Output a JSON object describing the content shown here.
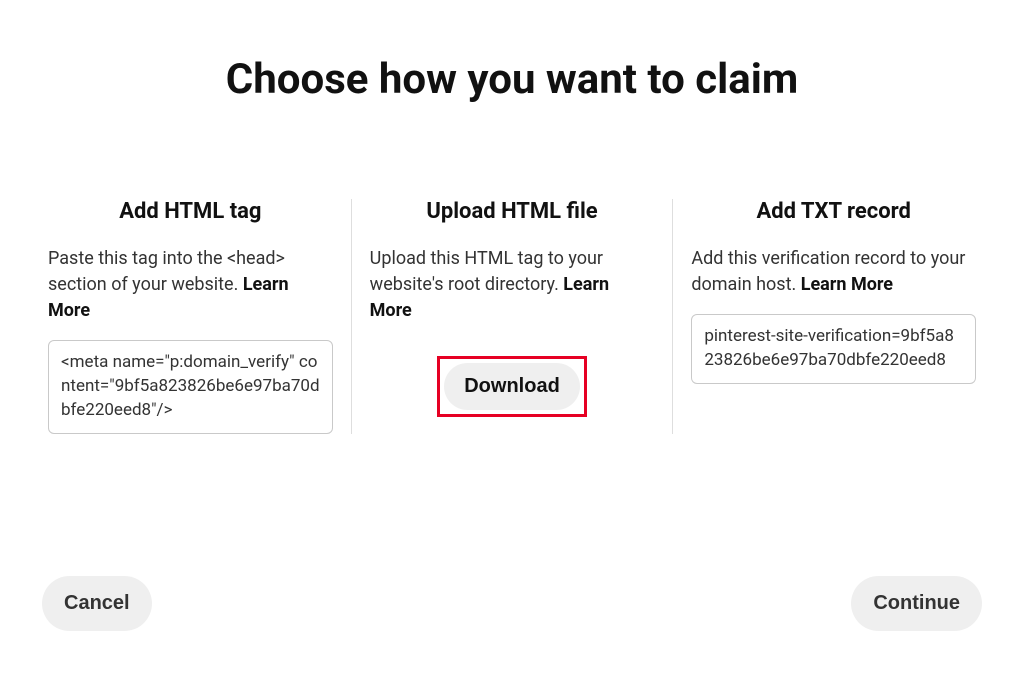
{
  "title": "Choose how you want to claim",
  "options": {
    "html_tag": {
      "title": "Add HTML tag",
      "desc": "Paste this tag into the <head> section of your website. ",
      "learn_more": "Learn More",
      "code": "<meta name=\"p:domain_verify\" content=\"9bf5a823826be6e97ba70dbfe220eed8\"/>"
    },
    "upload_file": {
      "title": "Upload HTML file",
      "desc": "Upload this HTML tag to your website's root directory. ",
      "learn_more": "Learn More",
      "download_label": "Download"
    },
    "txt_record": {
      "title": "Add TXT record",
      "desc": "Add this verification record to your domain host. ",
      "learn_more": "Learn More",
      "code": "pinterest-site-verification=9bf5a823826be6e97ba70dbfe220eed8"
    }
  },
  "footer": {
    "cancel_label": "Cancel",
    "continue_label": "Continue"
  }
}
